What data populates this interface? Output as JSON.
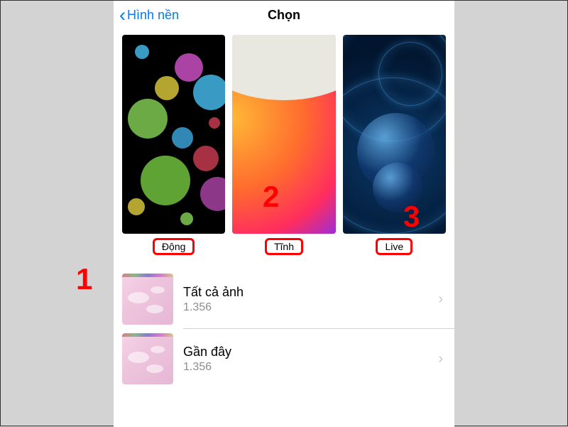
{
  "nav": {
    "back_label": "Hình nền",
    "title": "Chọn"
  },
  "wallpapers": [
    {
      "label": "Động",
      "type": "dynamic"
    },
    {
      "label": "Tĩnh",
      "type": "still"
    },
    {
      "label": "Live",
      "type": "live"
    }
  ],
  "albums": [
    {
      "title": "Tất cả ảnh",
      "count": "1.356"
    },
    {
      "title": "Gần đây",
      "count": "1.356"
    }
  ],
  "annotations": {
    "one": "1",
    "two": "2",
    "three": "3"
  }
}
